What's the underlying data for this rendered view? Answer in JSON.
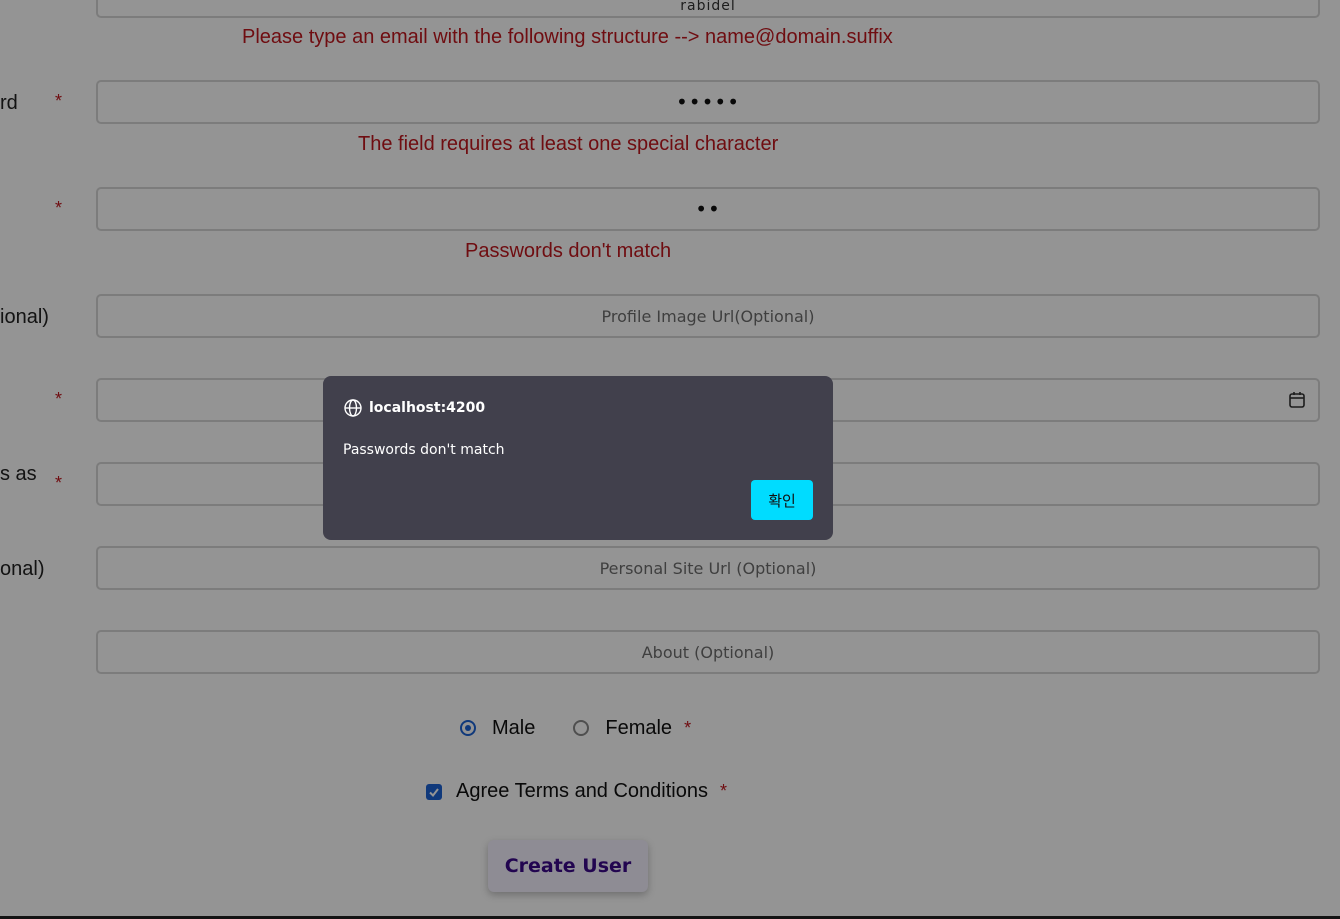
{
  "form": {
    "top_field_value": "rabidel",
    "email_error": "Please type an email with the following structure --> name@domain.suffix",
    "password_label": "rd",
    "password_value": "•••••",
    "password_error": "The field requires at least one special character",
    "confirm_value": "••",
    "confirm_error": "Passwords don't match",
    "profile_label": "ional)",
    "profile_placeholder": "Profile Image Url(Optional)",
    "birthday_value": "",
    "tag_label": "s as",
    "tag_value": "",
    "site_label": "onal)",
    "site_placeholder": "Personal Site Url (Optional)",
    "about_placeholder": "About (Optional)",
    "required_mark": "*",
    "gender": {
      "options": [
        "Male",
        "Female"
      ],
      "selected": "Male"
    },
    "agree_label": "Agree Terms and Conditions",
    "agree_checked": true,
    "submit_label": "Create User"
  },
  "dialog": {
    "origin": "localhost:4200",
    "message": "Passwords don't match",
    "ok_label": "확인"
  },
  "colors": {
    "error": "#c0171e",
    "accent": "#1c63d5",
    "dialog_bg": "#41404c",
    "dialog_button": "#00dcff",
    "submit_text": "#3b0a8a"
  }
}
